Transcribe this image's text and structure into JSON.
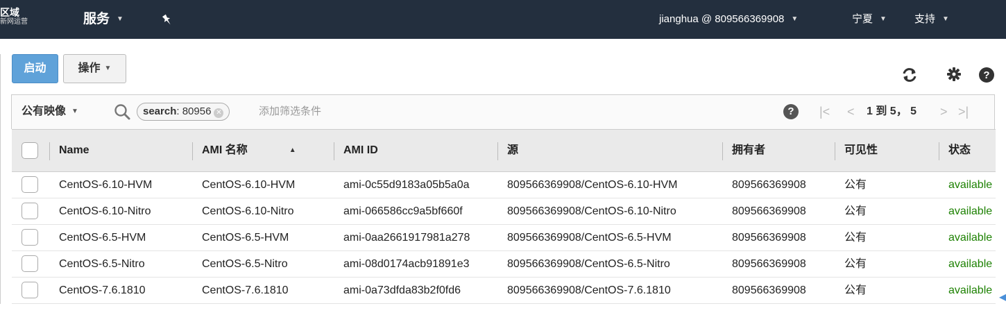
{
  "nav": {
    "region_title": "区域",
    "region_sub": "新网运营",
    "services": "服务",
    "user": "jianghua @ 809566369908",
    "region": "宁夏",
    "support": "支持"
  },
  "toolbar": {
    "launch_label": "启动",
    "actions_label": "操作",
    "refresh_icon": "refresh-icon",
    "settings_icon": "gear-icon",
    "help_icon": "help-icon"
  },
  "filter": {
    "select_value": "公有映像",
    "token_key": "search",
    "token_value": ": 80956",
    "placeholder": "添加筛选条件",
    "pager_text": "1 到 5， 5"
  },
  "table": {
    "columns": [
      "Name",
      "AMI 名称",
      "AMI ID",
      "源",
      "拥有者",
      "可见性",
      "状态"
    ],
    "rows": [
      [
        "CentOS-6.10-HVM",
        "CentOS-6.10-HVM",
        "ami-0c55d9183a05b5a0a",
        "809566369908/CentOS-6.10-HVM",
        "809566369908",
        "公有",
        "available"
      ],
      [
        "CentOS-6.10-Nitro",
        "CentOS-6.10-Nitro",
        "ami-066586cc9a5bf660f",
        "809566369908/CentOS-6.10-Nitro",
        "809566369908",
        "公有",
        "available"
      ],
      [
        "CentOS-6.5-HVM",
        "CentOS-6.5-HVM",
        "ami-0aa2661917981a278",
        "809566369908/CentOS-6.5-HVM",
        "809566369908",
        "公有",
        "available"
      ],
      [
        "CentOS-6.5-Nitro",
        "CentOS-6.5-Nitro",
        "ami-08d0174acb91891e3",
        "809566369908/CentOS-6.5-Nitro",
        "809566369908",
        "公有",
        "available"
      ],
      [
        "CentOS-7.6.1810",
        "CentOS-7.6.1810",
        "ami-0a73dfda83b2f0fd6",
        "809566369908/CentOS-7.6.1810",
        "809566369908",
        "公有",
        "available"
      ]
    ]
  },
  "colors": {
    "nav_bg": "#232f3e",
    "launch_bg": "#5fa2d9",
    "available": "#1d8102"
  }
}
